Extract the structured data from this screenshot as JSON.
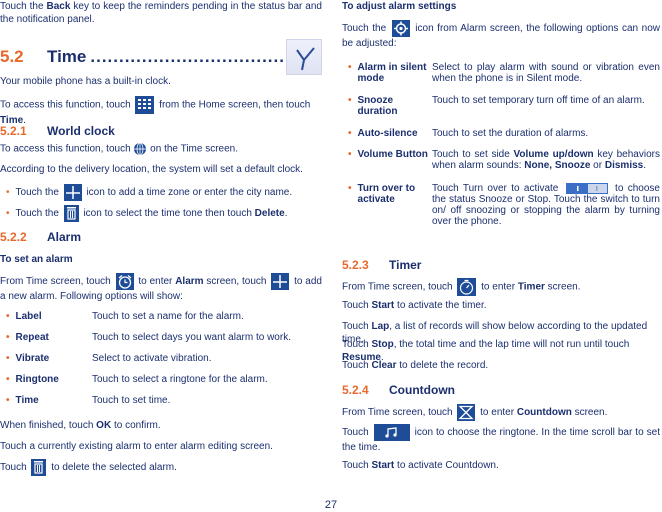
{
  "left": {
    "intro": {
      "pre": "Touch the ",
      "bold": "Back",
      "post": " key to keep the reminders pending in the status bar and the notification panel."
    },
    "section": {
      "number": "5.2",
      "title": "Time",
      "dots": "..................................................................",
      "icon": "clock-hands-icon"
    },
    "built_in": "Your mobile phone has a built-in clock.",
    "access": {
      "pre": "To access this function, touch ",
      "icon": "app-grid-icon",
      "mid": " from the Home screen, then touch ",
      "bold": "Time",
      "post": "."
    },
    "world_clock": {
      "number": "5.2.1",
      "title": "World clock",
      "access": {
        "pre": "To access this function, touch ",
        "icon": "globe-icon",
        "post": " on the Time screen."
      },
      "default": "According to the delivery location, the system will set a default clock.",
      "bullets": [
        {
          "pre": "Touch the ",
          "icon": "plus-icon",
          "post": " icon to add a time zone or enter the city name."
        },
        {
          "pre": "Touch the ",
          "icon": "trash-icon",
          "post": " icon to select the time tone then touch ",
          "bold": "Delete",
          "end": "."
        }
      ]
    },
    "alarm": {
      "number": "5.2.2",
      "title": "Alarm",
      "subheading": "To set an alarm",
      "intro": {
        "p1": "From Time screen, touch ",
        "icon1": "alarm-clock-icon",
        "p2": " to enter ",
        "bold": "Alarm",
        "p3": " screen, touch ",
        "icon2": "plus-icon",
        "p4": " to add a new alarm. Following options will show:"
      },
      "options": [
        {
          "label": "Label",
          "desc": "Touch to set a name for the alarm."
        },
        {
          "label": "Repeat",
          "desc": "Touch to select days you want alarm to work."
        },
        {
          "label": "Vibrate",
          "desc": "Select to activate vibration."
        },
        {
          "label": "Ringtone",
          "desc": "Touch to select a ringtone for the alarm."
        },
        {
          "label": "Time",
          "desc": "Touch to set time."
        }
      ],
      "finish": {
        "pre": "When finished, touch ",
        "bold": "OK",
        "post": " to confirm."
      },
      "edit": "Touch a currently existing alarm to enter alarm editing screen.",
      "delete": {
        "pre": "Touch ",
        "icon": "trash-icon",
        "post": " to delete the selected alarm."
      }
    }
  },
  "right": {
    "settings_heading": "To adjust alarm settings",
    "settings_intro": {
      "pre": "Touch the ",
      "icon": "gear-icon",
      "post": " icon from Alarm screen, the following options can now be adjusted:"
    },
    "settings": [
      {
        "label": "Alarm in silent mode",
        "desc": "Select to play alarm with sound or vibration even when the phone is in Silent mode."
      },
      {
        "label": "Snooze duration",
        "desc": "Touch to set temporary turn off time of an alarm."
      },
      {
        "label": "Auto-silence",
        "desc": "Touch to set the duration of alarms."
      },
      {
        "label": "Volume Button",
        "desc_pre": "Touch to set side ",
        "desc_b1": "Volume up/down",
        "desc_mid": " key behaviors when alarm sounds: ",
        "desc_b2": "None, Snooze",
        "desc_or": " or ",
        "desc_b3": "Dismiss",
        "desc_end": "."
      },
      {
        "label": "Turn over to activate",
        "desc_pre": "Touch Turn over to activate ",
        "icon": "toggle-switch-icon",
        "desc_post": " to choose the status Snooze or Stop. Touch the switch to turn on/ off snoozing or stopping the alarm by turning over the phone."
      }
    ],
    "timer": {
      "number": "5.2.3",
      "title": "Timer",
      "lines": [
        {
          "pre": "From Time screen, touch ",
          "icon": "stopwatch-icon",
          "post": " to enter ",
          "bold": "Timer",
          "end": " screen."
        },
        {
          "pre": "Touch ",
          "bold": "Start",
          "post": " to activate the timer."
        },
        {
          "pre": "Touch ",
          "bold": "Lap",
          "post": ", a list of records will show below according to the updated time."
        },
        {
          "pre": "Touch ",
          "bold": "Stop",
          "post": ", the total time and the lap time will not run until touch ",
          "bold2": "Resume",
          "end": "."
        },
        {
          "pre": "Touch ",
          "bold": "Clear",
          "post": " to delete the record."
        }
      ]
    },
    "countdown": {
      "number": "5.2.4",
      "title": "Countdown",
      "line1": {
        "pre": "From Time screen, touch ",
        "icon": "hourglass-icon",
        "post": " to enter ",
        "bold": "Countdown",
        "end": " screen."
      },
      "line2": {
        "pre": "Touch ",
        "icon": "music-note-icon",
        "post": " icon to choose the ringtone. In the time scroll bar to set the time."
      },
      "line3": {
        "pre": "Touch ",
        "bold": "Start",
        "post": " to activate Countdown."
      }
    }
  },
  "footer": {
    "page_number": "27"
  }
}
